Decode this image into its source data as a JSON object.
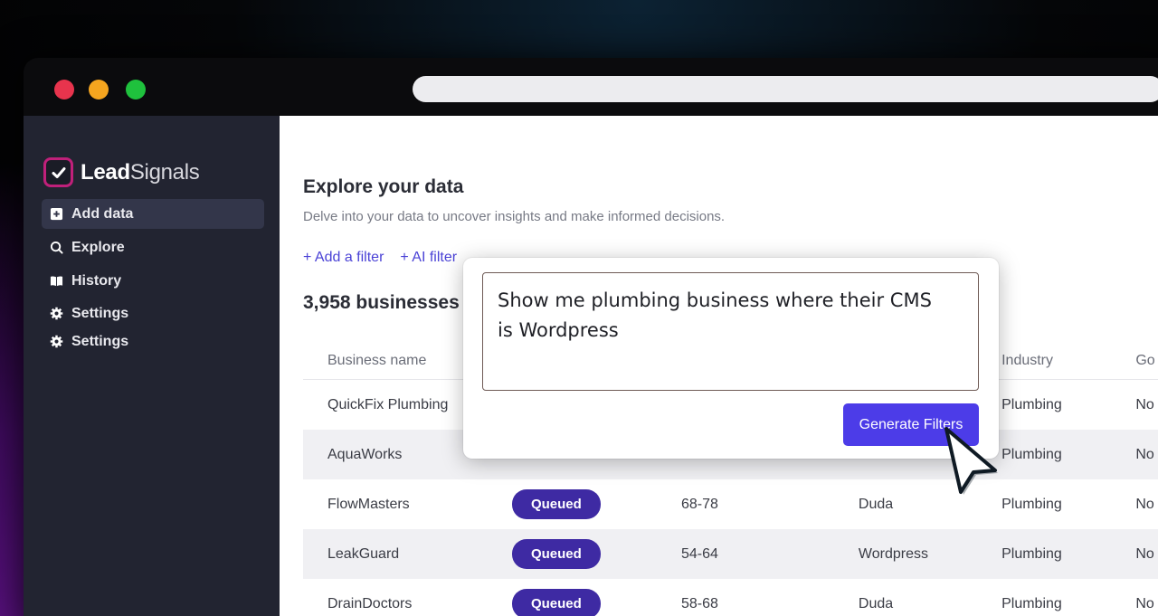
{
  "app": {
    "name_bold": "Lead",
    "name_light": "Signals",
    "brand_color": "#c0207a",
    "accent_color": "#4c3ce8"
  },
  "sidebar": {
    "items": [
      {
        "label": "Add data",
        "icon": "plus-square-icon",
        "active": true
      },
      {
        "label": "Explore",
        "icon": "search-icon",
        "active": false
      },
      {
        "label": "History",
        "icon": "book-icon",
        "active": false
      },
      {
        "label": "Settings",
        "icon": "gear-icon",
        "active": false
      },
      {
        "label": "Settings",
        "icon": "gear-icon",
        "active": false
      }
    ]
  },
  "main": {
    "title": "Explore your data",
    "subtitle": "Delve into your data to uncover insights and make informed decisions.",
    "add_filter_label": "+ Add a filter",
    "ai_filter_label": "+ AI filter",
    "count_label": "3,958 businesses"
  },
  "table": {
    "columns": [
      "Business name",
      "",
      "",
      "",
      "Industry",
      "Go"
    ],
    "rows": [
      {
        "name": "QuickFix Plumbing",
        "status": "",
        "range": "",
        "cms": "",
        "industry": "Plumbing",
        "extra": "No"
      },
      {
        "name": "AquaWorks",
        "status": "",
        "range": "",
        "cms": "",
        "industry": "Plumbing",
        "extra": "No"
      },
      {
        "name": "FlowMasters",
        "status": "Queued",
        "range": "68-78",
        "cms": "Duda",
        "industry": "Plumbing",
        "extra": "No"
      },
      {
        "name": "LeakGuard",
        "status": "Queued",
        "range": "54-64",
        "cms": "Wordpress",
        "industry": "Plumbing",
        "extra": "No"
      },
      {
        "name": "DrainDoctors",
        "status": "Queued",
        "range": "58-68",
        "cms": "Duda",
        "industry": "Plumbing",
        "extra": "No"
      }
    ]
  },
  "ai_popover": {
    "prompt_line1": "Show me plumbing business where their CMS",
    "prompt_line2": "is Wordpress",
    "button_label": "Generate Filters"
  }
}
